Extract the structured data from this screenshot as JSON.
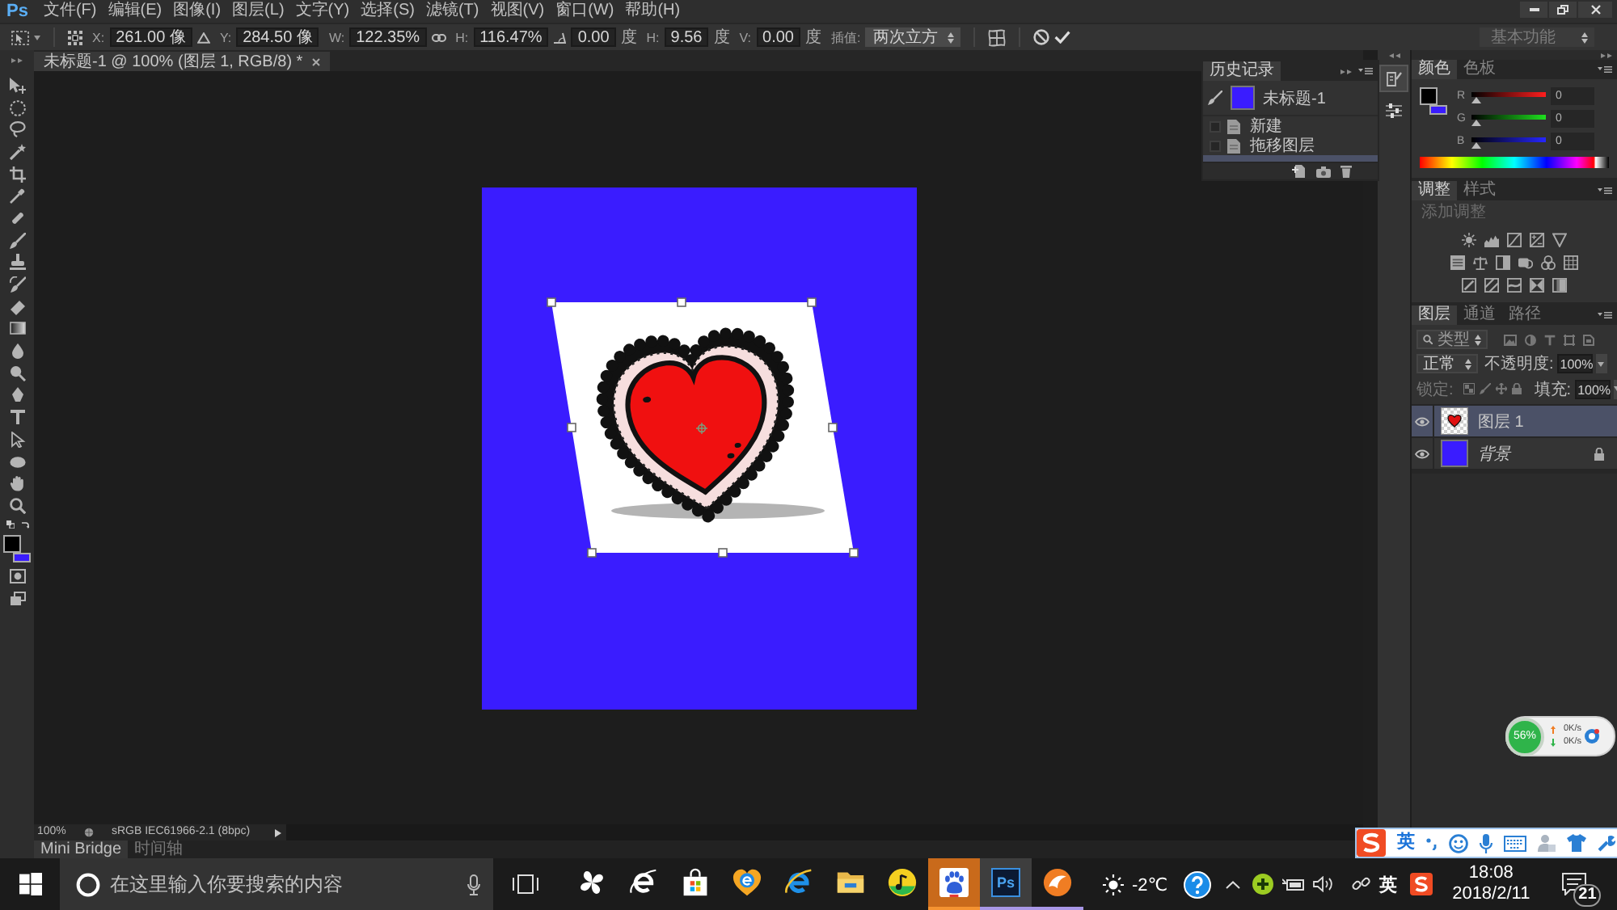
{
  "app": {
    "logo": "Ps"
  },
  "menu": [
    "文件(F)",
    "编辑(E)",
    "图像(I)",
    "图层(L)",
    "文字(Y)",
    "选择(S)",
    "滤镜(T)",
    "视图(V)",
    "窗口(W)",
    "帮助(H)"
  ],
  "options_bar": {
    "fields": [
      {
        "label": "X:",
        "value": "261.00 像"
      },
      {
        "label": "Y:",
        "value": "284.50 像"
      },
      {
        "label": "W:",
        "value": "122.35%"
      },
      {
        "label": "H:",
        "value": "116.47%"
      },
      {
        "value": "0.00",
        "unit": "度"
      },
      {
        "label": "H:",
        "value": "9.56",
        "unit": "度"
      },
      {
        "label": "V:",
        "value": "0.00",
        "unit": "度"
      }
    ],
    "interpolation": {
      "label": "插值:",
      "value": "两次立方"
    },
    "workspace": "基本功能"
  },
  "document": {
    "tab": "未标题-1 @ 100% (图层 1, RGB/8) *"
  },
  "toolbox": {
    "colors": [
      {
        "color": "#000000"
      },
      {
        "color": "#3a1cff"
      }
    ]
  },
  "history": {
    "tabs": [
      {
        "label": "历史记录",
        "selected": true
      }
    ],
    "snapshot": "未标题-1",
    "items": [
      {
        "label": "新建",
        "selected": false
      },
      {
        "label": "拖移图层",
        "selected": false
      },
      {
        "selected": true
      }
    ]
  },
  "dock_icons": [
    {
      "kind": "history",
      "selected": true
    },
    {
      "kind": "properties",
      "selected": false
    }
  ],
  "color_panel": {
    "tabs": [
      {
        "label": "颜色",
        "selected": true
      },
      {
        "label": "色板",
        "selected": false
      }
    ],
    "swatches": [
      {
        "color": "#000000"
      },
      {
        "color": "#3a1cff"
      }
    ],
    "channels": [
      {
        "label": "R",
        "level": 0,
        "value": "0"
      },
      {
        "label": "G",
        "level": 0,
        "value": "0"
      },
      {
        "label": "B",
        "level": 0,
        "value": "0"
      }
    ]
  },
  "adjustments_panel": {
    "tabs": [
      {
        "label": "调整",
        "selected": true
      },
      {
        "label": "样式",
        "selected": false
      }
    ],
    "hint": "添加调整"
  },
  "layers_panel": {
    "tabs": [
      {
        "label": "图层",
        "selected": true
      },
      {
        "label": "通道",
        "selected": false
      },
      {
        "label": "路径",
        "selected": false
      }
    ],
    "filter": "类型",
    "blend_mode": "正常",
    "opacity": {
      "label": "不透明度:",
      "value": "100%"
    },
    "lock_label": "锁定:",
    "fill": {
      "label": "填充:",
      "value": "100%"
    },
    "layers": [
      {
        "name": "图层 1",
        "kind": "image",
        "selected": true,
        "visible": true,
        "locked": false
      },
      {
        "name": "背景",
        "kind": "background",
        "selected": false,
        "visible": true,
        "locked": true
      }
    ]
  },
  "status_bar": {
    "zoom": "100%",
    "profile": "sRGB IEC61966-2.1 (8bpc)"
  },
  "bottom_tabs": [
    {
      "label": "Mini Bridge",
      "selected": true
    },
    {
      "label": "时间轴",
      "selected": false
    }
  ],
  "taskbar": {
    "search_placeholder": "在这里输入你要搜索的内容",
    "apps": [
      {
        "kind": "pinwheel",
        "running": false,
        "active": false,
        "flashing": false
      },
      {
        "kind": "e-ring",
        "running": false,
        "active": false,
        "flashing": false
      },
      {
        "kind": "store",
        "running": false,
        "active": false,
        "flashing": false
      },
      {
        "kind": "heart-e",
        "running": false,
        "active": false,
        "flashing": false
      },
      {
        "kind": "e-blue",
        "running": false,
        "active": false,
        "flashing": false
      },
      {
        "kind": "folder",
        "running": false,
        "active": false,
        "flashing": false
      },
      {
        "kind": "music",
        "running": false,
        "active": false,
        "flashing": false
      },
      {
        "kind": "paw",
        "running": true,
        "active": false,
        "flashing": true
      },
      {
        "kind": "ps",
        "label": "Ps",
        "running": true,
        "active": true,
        "flashing": false
      },
      {
        "kind": "orange",
        "running": true,
        "active": false,
        "flashing": false
      }
    ],
    "weather": "-2℃",
    "language": "英",
    "time": "18:08",
    "date": "2018/2/11",
    "notifications": "21"
  },
  "speed_widget": {
    "percent": "56%",
    "upload": "0K/s",
    "download": "0K/s"
  },
  "ime_toolbar": {
    "mode": "英"
  }
}
